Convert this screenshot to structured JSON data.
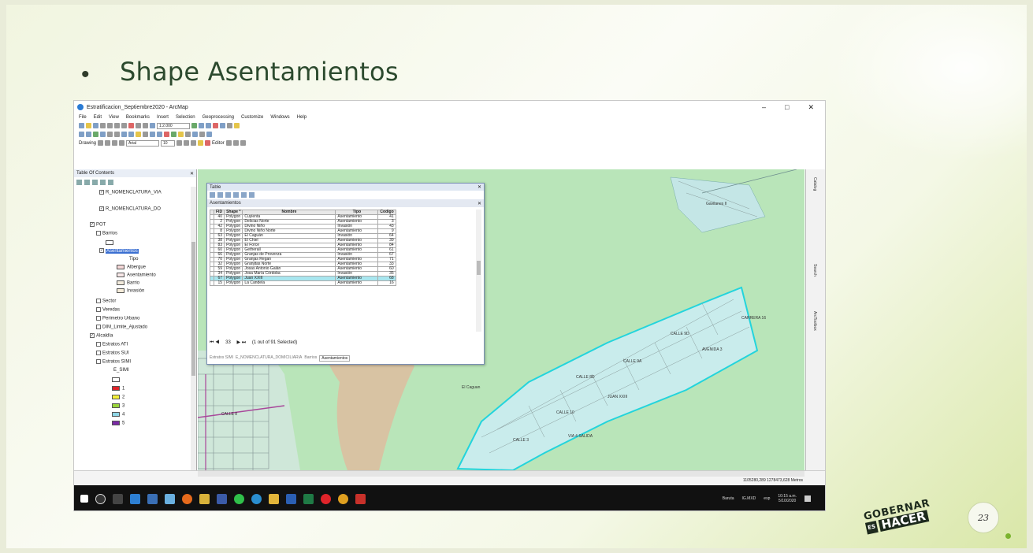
{
  "slide": {
    "bullet": "•",
    "title": "Shape Asentamientos",
    "page_number": "23"
  },
  "logo": {
    "line1": "GOBERNAR",
    "es": "ES",
    "hacer": "HACER"
  },
  "app": {
    "title": "Estratificacion_Septiembre2020 - ArcMap",
    "menu": [
      "File",
      "Edit",
      "View",
      "Bookmarks",
      "Insert",
      "Selection",
      "Geoprocessing",
      "Customize",
      "Windows",
      "Help"
    ],
    "scale": "1:2.000",
    "drawing_label": "Drawing",
    "font": "Arial",
    "font_size": "10",
    "editor_label": "Editor"
  },
  "toc": {
    "title": "Table Of Contents",
    "items": [
      {
        "label": "R_NOMENCLATURA_VIA",
        "checked": true
      },
      {
        "label": "R_NOMENCLATURA_DO",
        "checked": true
      },
      {
        "label": "POT",
        "checked": true
      },
      {
        "label": "Barrios",
        "checked": false
      },
      {
        "label": "Asentamientos",
        "checked": true
      },
      {
        "label": "Tipo",
        "checked": false
      },
      {
        "label": "Albergue",
        "checked": false
      },
      {
        "label": "Asentamiento",
        "checked": false
      },
      {
        "label": "Barrio",
        "checked": false
      },
      {
        "label": "Invasión",
        "checked": false
      },
      {
        "label": "Sector",
        "checked": false
      },
      {
        "label": "Veredas",
        "checked": false
      },
      {
        "label": "Perimetro Urbano",
        "checked": false
      },
      {
        "label": "DIM_Limite_Ajustado",
        "checked": false
      },
      {
        "label": "Alcaldía",
        "checked": true
      },
      {
        "label": "Estratos ATI",
        "checked": false
      },
      {
        "label": "Estratos SUI",
        "checked": false
      },
      {
        "label": "Estratos SIMI",
        "checked": false
      },
      {
        "label": "E_SIMI",
        "checked": false
      },
      {
        "label": "1",
        "checked": false
      },
      {
        "label": "2",
        "checked": false
      },
      {
        "label": "3",
        "checked": false
      },
      {
        "label": "4",
        "checked": false
      },
      {
        "label": "5",
        "checked": false
      }
    ],
    "colors": {
      "albergue": "#f4d7d7",
      "asentamiento": "#f8e8e8",
      "barrio": "#f2eadb",
      "invasion": "#f6ecd9",
      "c1": "#e0242a",
      "c2": "#f2ef3a",
      "c3": "#9ad53c",
      "c4": "#8fd6e6",
      "c5": "#7b2aa6"
    }
  },
  "table": {
    "window_title": "Table",
    "layer_name": "Asentamientos",
    "columns": [
      "FID",
      "Shape *",
      "Nombre",
      "Tipo",
      "Codigo"
    ],
    "rows": [
      [
        "40",
        "Polygon",
        "Cuyienta",
        "Asentamiento",
        "41"
      ],
      [
        "2",
        "Polygon",
        "Delicias Norte",
        "Asentamiento",
        "3"
      ],
      [
        "42",
        "Polygon",
        "Divino Niño",
        "Invasión",
        "43"
      ],
      [
        "8",
        "Polygon",
        "Divino Niño Norte",
        "Asentamiento",
        "9"
      ],
      [
        "63",
        "Polygon",
        "El Caguán",
        "Invasión",
        "64"
      ],
      [
        "38",
        "Polygon",
        "El Chiel",
        "Asentamiento",
        "39"
      ],
      [
        "83",
        "Polygon",
        "El Force",
        "Asentamiento",
        "84"
      ],
      [
        "60",
        "Polygon",
        "Getherall",
        "Asentamiento",
        "61"
      ],
      [
        "66",
        "Polygon",
        "Granjas de Provenza",
        "Invasión",
        "67"
      ],
      [
        "70",
        "Polygon",
        "Granjas Regan",
        "Asentamiento",
        "71"
      ],
      [
        "32",
        "Polygon",
        "Granjitas Norte",
        "Asentamiento",
        "33"
      ],
      [
        "59",
        "Polygon",
        "Josas Antonio Galán",
        "Asentamiento",
        "60"
      ],
      [
        "34",
        "Polygon",
        "Josa María Córdoba",
        "Invasión",
        "35"
      ],
      [
        "67",
        "Polygon",
        "Juan XXIII",
        "Asentamiento",
        "68"
      ],
      [
        "15",
        "Polygon",
        "La Candela",
        "Asentamiento",
        "16"
      ]
    ],
    "highlight_row": 13,
    "record_number": "33",
    "selected_text": "(1 out of 91 Selected)",
    "tabs": [
      "Estratos SIMI",
      "E_NOMENCLATURA_DOMICILIARIA",
      "Barrios",
      "Asentamientos"
    ]
  },
  "map": {
    "labels": [
      "El Caguan",
      "CALLE 8D",
      "CALLE 9D",
      "CALLE 9A",
      "CALLE 10",
      "VIA 4 SALIDA",
      "CALLE 3",
      "AVENIDA 3",
      "CALLE 8",
      "JUAN XXIII",
      "Gavilanes II",
      "CARRERA 16"
    ],
    "colors": {
      "land": "#b8e4b8",
      "river": "#cfe7d9",
      "sand": "#d8c3a3",
      "selection": "#23d4dc",
      "parcel": "#ffffff",
      "road": "#a8479a"
    }
  },
  "right_panel": [
    "Catalog",
    "Search",
    "ArcToolbox"
  ],
  "status": {
    "coords": "1105280,289  1278473,628 Metros"
  },
  "taskbar": {
    "weather": "Baruta",
    "temp": "IG.MXD",
    "lang": "esp",
    "time": "10:15 a.m.",
    "date": "5/10/2020"
  }
}
